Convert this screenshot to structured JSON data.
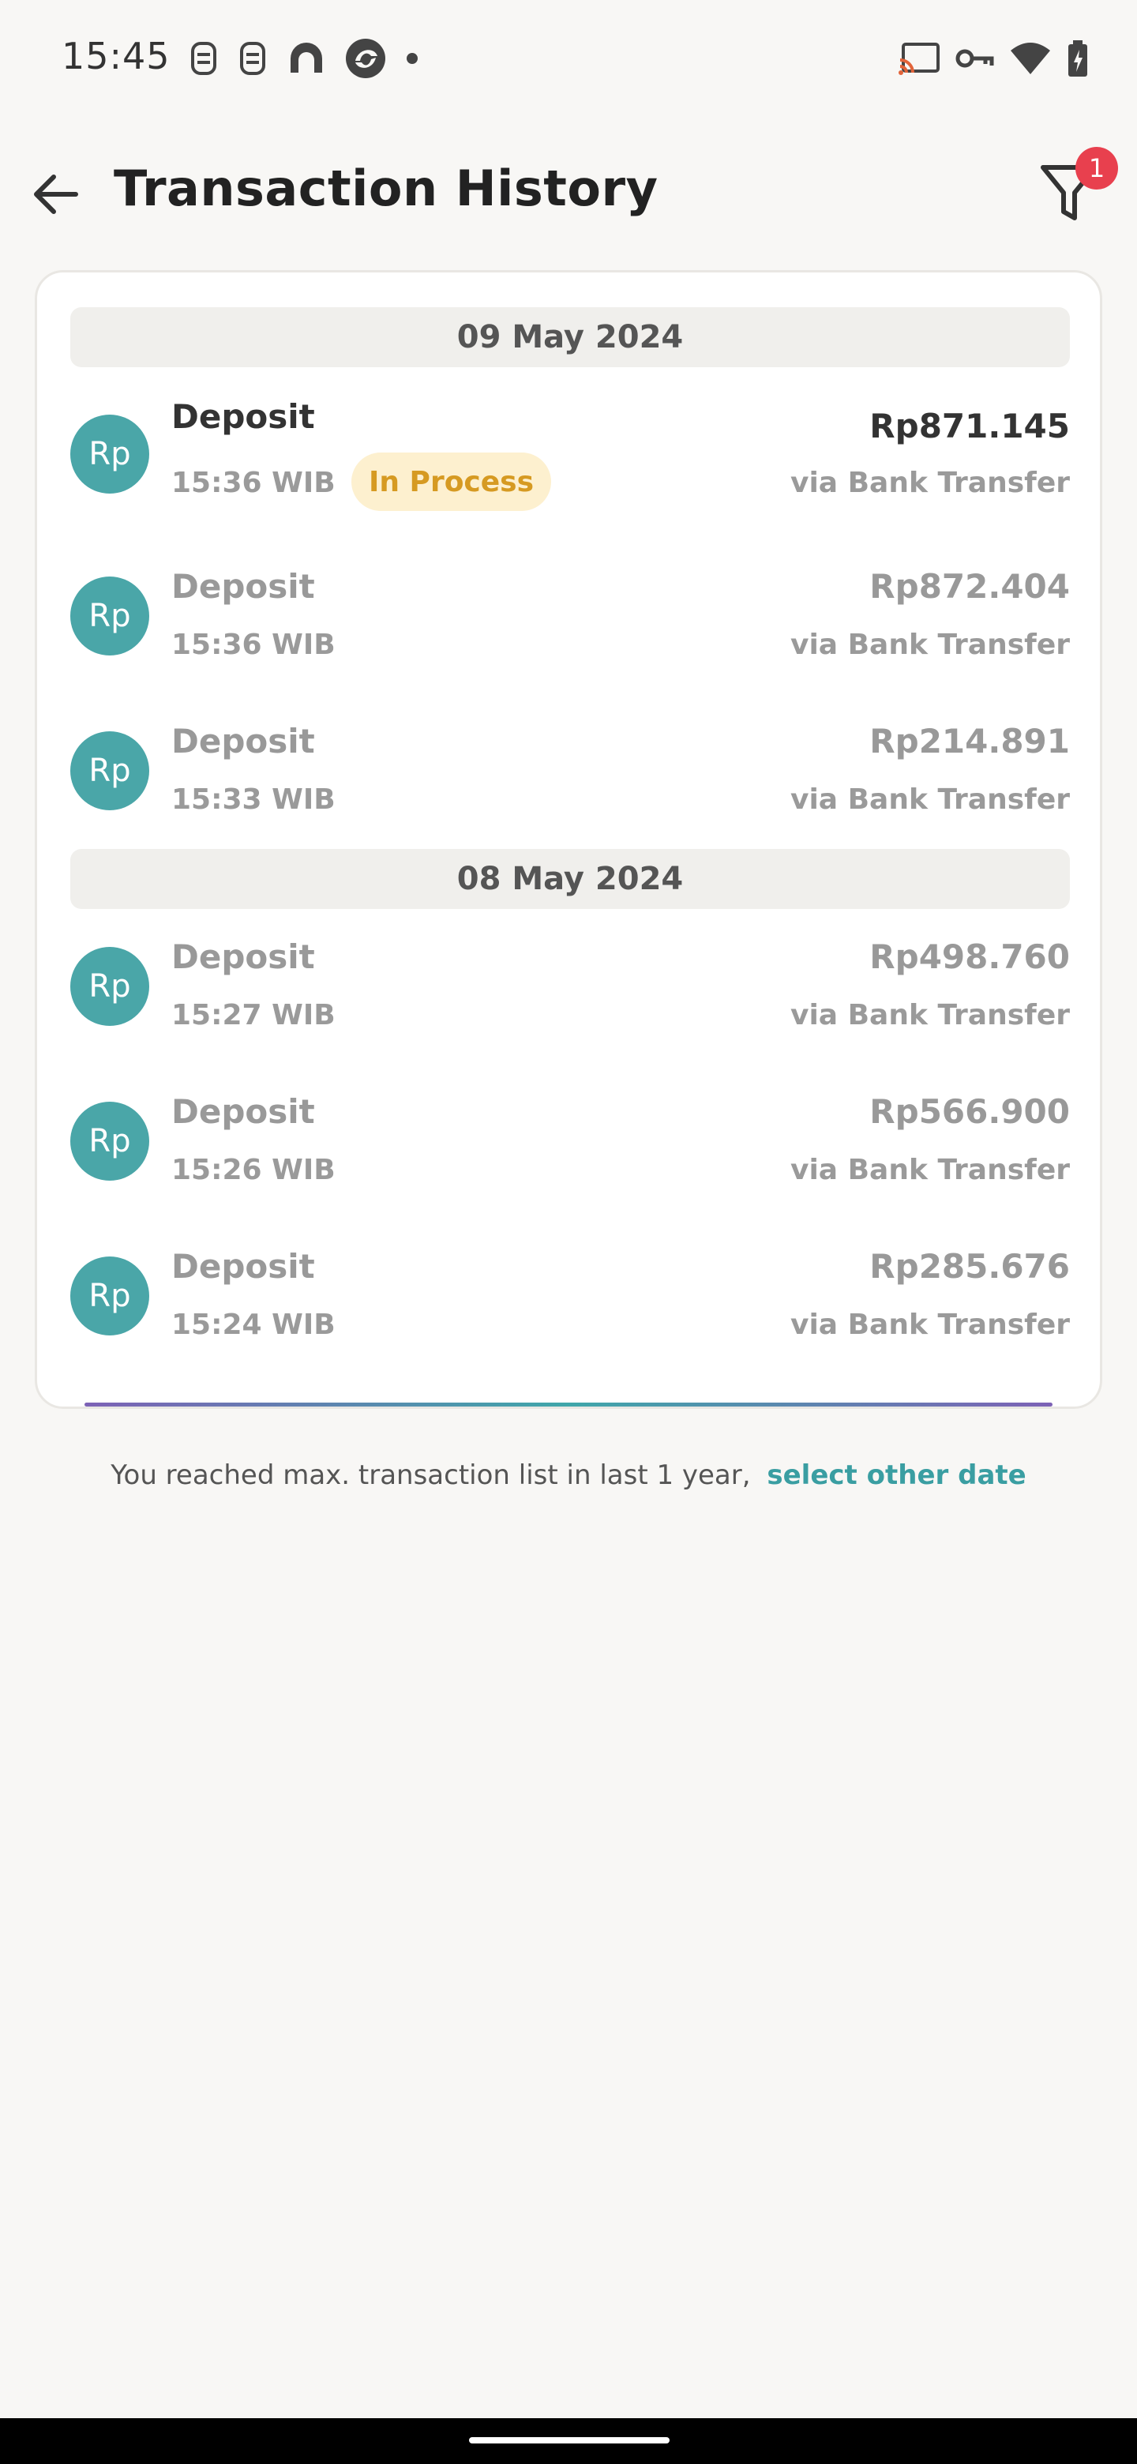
{
  "status_bar": {
    "time": "15:45",
    "left_icons": [
      "notification-icon",
      "notification-icon",
      "app-icon",
      "app-icon",
      "dot-icon"
    ],
    "right_icons": [
      "cast-icon",
      "key-icon",
      "wifi-icon",
      "battery-icon"
    ]
  },
  "header": {
    "title": "Transaction History",
    "filter_badge": "1"
  },
  "groups": [
    {
      "date": "09 May 2024",
      "transactions": [
        {
          "avatar": "Rp",
          "title": "Deposit",
          "time": "15:36 WIB",
          "status": "In Process",
          "amount": "Rp871.145",
          "method": "via Bank Transfer"
        },
        {
          "avatar": "Rp",
          "title": "Deposit",
          "time": "15:36 WIB",
          "amount": "Rp872.404",
          "method": "via Bank Transfer"
        },
        {
          "avatar": "Rp",
          "title": "Deposit",
          "time": "15:33 WIB",
          "amount": "Rp214.891",
          "method": "via Bank Transfer"
        }
      ]
    },
    {
      "date": "08 May 2024",
      "transactions": [
        {
          "avatar": "Rp",
          "title": "Deposit",
          "time": "15:27 WIB",
          "amount": "Rp498.760",
          "method": "via Bank Transfer"
        },
        {
          "avatar": "Rp",
          "title": "Deposit",
          "time": "15:26 WIB",
          "amount": "Rp566.900",
          "method": "via Bank Transfer"
        },
        {
          "avatar": "Rp",
          "title": "Deposit",
          "time": "15:24 WIB",
          "amount": "Rp285.676",
          "method": "via Bank Transfer"
        }
      ]
    }
  ],
  "footer": {
    "note": "You reached max. transaction list in last 1 year,",
    "link": "select other date"
  },
  "colors": {
    "accent": "#3a9ea2",
    "avatar": "#4aa6a8",
    "badge": "#e8404e",
    "pending_bg": "#fdf0cf",
    "pending_text": "#d69a22"
  }
}
